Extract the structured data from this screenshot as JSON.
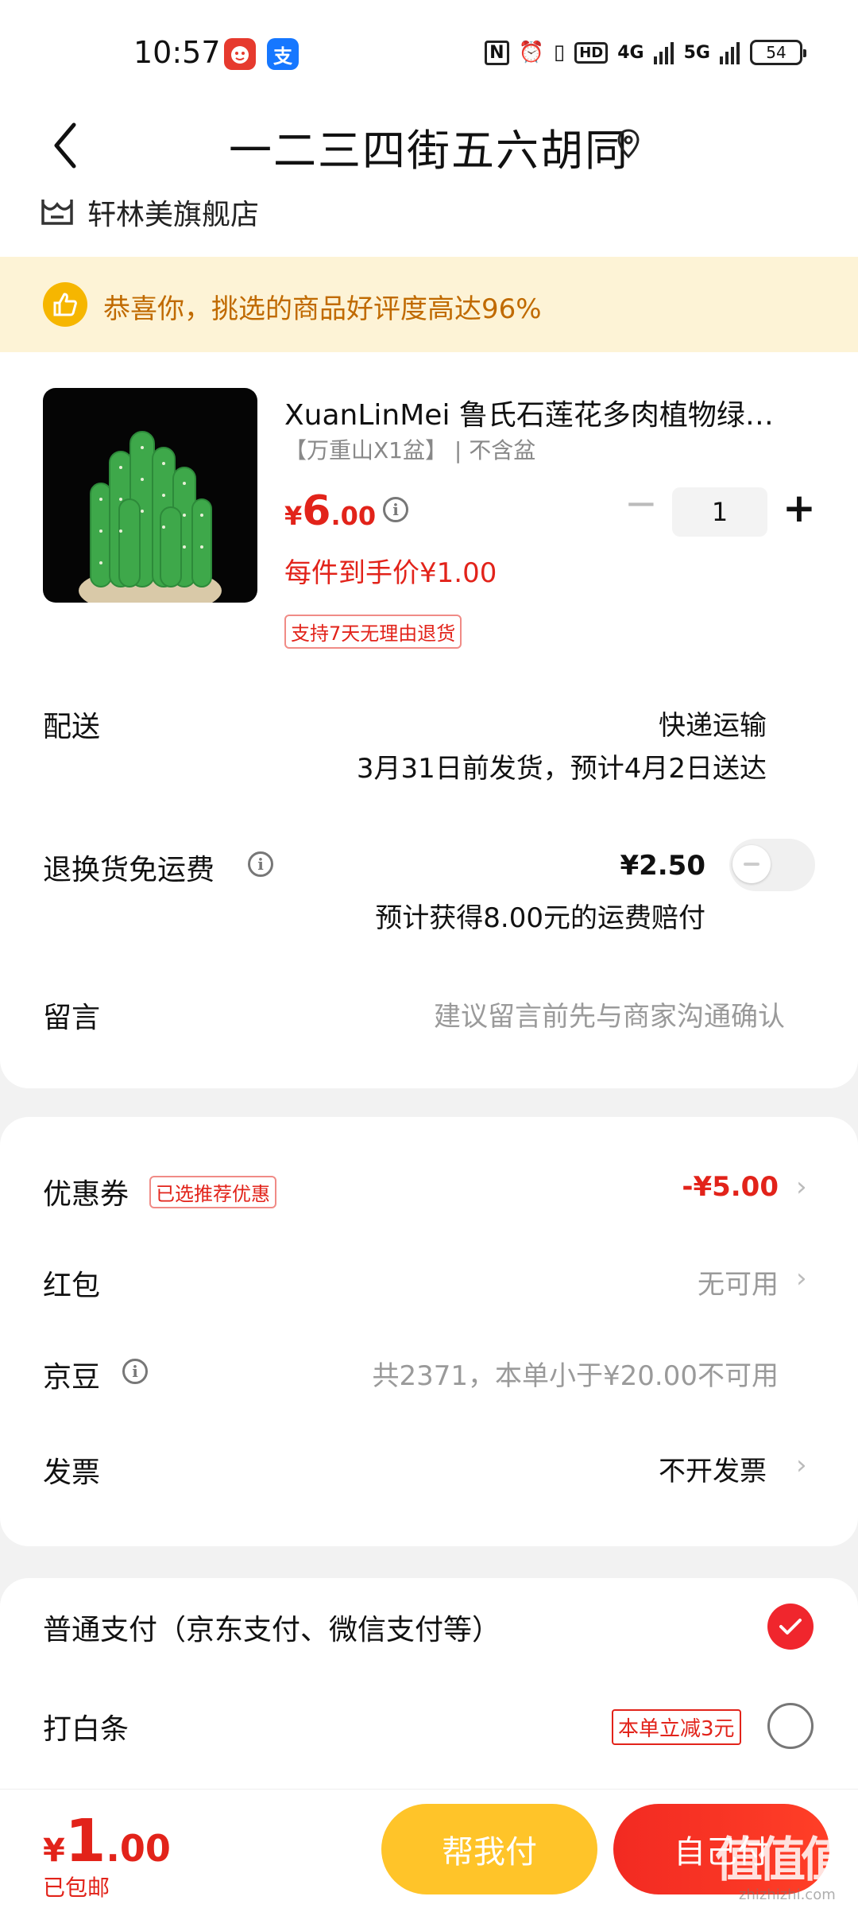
{
  "status_bar": {
    "time": "10:57",
    "app_icons": [
      "jd-app-icon",
      "alipay-icon"
    ],
    "alipay_glyph": "支",
    "nfc": "N",
    "alarm": "⏰",
    "vibrate": "▯",
    "hd": "HD",
    "network1": "4G",
    "network2": "5G",
    "battery": "54"
  },
  "header": {
    "title": "一二三四街五六胡同"
  },
  "store": {
    "name": "轩林美旗舰店"
  },
  "banner": {
    "text": "恭喜你，挑选的商品好评度高达96%"
  },
  "product": {
    "title": "XuanLinMei 鲁氏石莲花多肉植物绿…",
    "spec": "【万重山X1盆】 | 不含盆",
    "price_currency": "¥",
    "price_int": "6",
    "price_dec": ".00",
    "quantity": "1",
    "per_price": "每件到手价¥1.00",
    "return_policy": "支持7天无理由退货"
  },
  "delivery": {
    "label": "配送",
    "method": "快递运输",
    "eta": "3月31日前发货，预计4月2日送达"
  },
  "return_shipping": {
    "label": "退换货免运费",
    "price": "¥2.50",
    "note": "预计获得8.00元的运费赔付",
    "enabled": false
  },
  "message": {
    "label": "留言",
    "placeholder": "建议留言前先与商家沟通确认"
  },
  "discounts": {
    "coupon_label": "优惠券",
    "coupon_tag": "已选推荐优惠",
    "coupon_value": "-¥5.00",
    "redpacket_label": "红包",
    "redpacket_value": "无可用",
    "jingdou_label": "京豆",
    "jingdou_value": "共2371，本单小于¥20.00不可用",
    "invoice_label": "发票",
    "invoice_value": "不开发票"
  },
  "payment": {
    "normal_label": "普通支付（京东支付、微信支付等）",
    "normal_selected": true,
    "baitiao_label": "打白条",
    "baitiao_tag": "本单立减3元",
    "baitiao_selected": false
  },
  "bottom": {
    "total_currency": "¥",
    "total_int": "1",
    "total_dec": ".00",
    "shipping_note": "已包邮",
    "help_pay": "帮我付",
    "self_pay": "自己付",
    "watermark": "值值值",
    "watermark_sub": "zhizhizhi.com"
  },
  "colors": {
    "accent_red": "#e2231a",
    "help_yellow": "#ffc429",
    "banner_bg": "#fdf3d6"
  }
}
